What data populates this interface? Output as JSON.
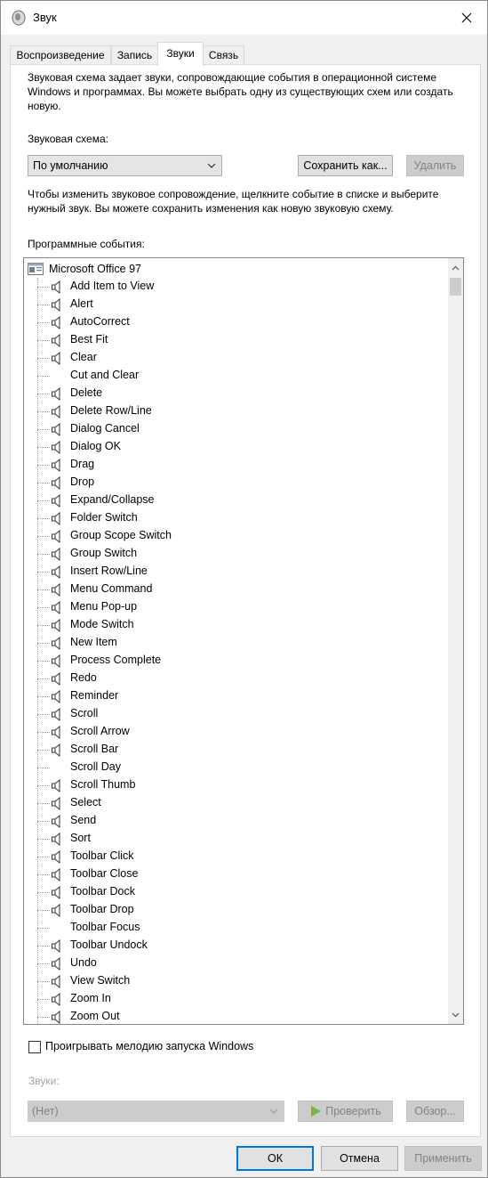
{
  "window": {
    "title": "Звук"
  },
  "tabs": [
    {
      "label": "Воспроизведение"
    },
    {
      "label": "Запись"
    },
    {
      "label": "Звуки"
    },
    {
      "label": "Связь"
    }
  ],
  "intro_text": "Звуковая схема задает звуки, сопровождающие события в операционной системе Windows и программах. Вы можете выбрать одну из существующих схем или создать новую.",
  "scheme": {
    "label": "Звуковая схема:",
    "selected": "По умолчанию",
    "save_button": "Сохранить как...",
    "delete_button": "Удалить"
  },
  "instructions_text": "Чтобы изменить звуковое сопровождение, щелкните событие в списке и выберите нужный звук. Вы можете сохранить изменения как новую звуковую схему.",
  "events": {
    "label": "Программные события:",
    "root": "Microsoft Office 97",
    "items": [
      {
        "label": "Add Item to View",
        "has_sound": true
      },
      {
        "label": "Alert",
        "has_sound": true
      },
      {
        "label": "AutoCorrect",
        "has_sound": true
      },
      {
        "label": "Best Fit",
        "has_sound": true
      },
      {
        "label": "Clear",
        "has_sound": true
      },
      {
        "label": "Cut and Clear",
        "has_sound": false
      },
      {
        "label": "Delete",
        "has_sound": true
      },
      {
        "label": "Delete Row/Line",
        "has_sound": true
      },
      {
        "label": "Dialog Cancel",
        "has_sound": true
      },
      {
        "label": "Dialog OK",
        "has_sound": true
      },
      {
        "label": "Drag",
        "has_sound": true
      },
      {
        "label": "Drop",
        "has_sound": true
      },
      {
        "label": "Expand/Collapse",
        "has_sound": true
      },
      {
        "label": "Folder Switch",
        "has_sound": true
      },
      {
        "label": "Group Scope Switch",
        "has_sound": true
      },
      {
        "label": "Group Switch",
        "has_sound": true
      },
      {
        "label": "Insert Row/Line",
        "has_sound": true
      },
      {
        "label": "Menu Command",
        "has_sound": true
      },
      {
        "label": "Menu Pop-up",
        "has_sound": true
      },
      {
        "label": "Mode Switch",
        "has_sound": true
      },
      {
        "label": "New Item",
        "has_sound": true
      },
      {
        "label": "Process Complete",
        "has_sound": true
      },
      {
        "label": "Redo",
        "has_sound": true
      },
      {
        "label": "Reminder",
        "has_sound": true
      },
      {
        "label": "Scroll",
        "has_sound": true
      },
      {
        "label": "Scroll Arrow",
        "has_sound": true
      },
      {
        "label": "Scroll Bar",
        "has_sound": true
      },
      {
        "label": "Scroll Day",
        "has_sound": false
      },
      {
        "label": "Scroll Thumb",
        "has_sound": true
      },
      {
        "label": "Select",
        "has_sound": true
      },
      {
        "label": "Send",
        "has_sound": true
      },
      {
        "label": "Sort",
        "has_sound": true
      },
      {
        "label": "Toolbar Click",
        "has_sound": true
      },
      {
        "label": "Toolbar Close",
        "has_sound": true
      },
      {
        "label": "Toolbar Dock",
        "has_sound": true
      },
      {
        "label": "Toolbar Drop",
        "has_sound": true
      },
      {
        "label": "Toolbar Focus",
        "has_sound": false
      },
      {
        "label": "Toolbar Undock",
        "has_sound": true
      },
      {
        "label": "Undo",
        "has_sound": true
      },
      {
        "label": "View Switch",
        "has_sound": true
      },
      {
        "label": "Zoom In",
        "has_sound": true
      },
      {
        "label": "Zoom Out",
        "has_sound": true
      }
    ]
  },
  "startup_checkbox": {
    "label": "Проигрывать мелодию запуска Windows",
    "checked": false
  },
  "sounds": {
    "label": "Звуки:",
    "selected": "(Нет)",
    "test_button": "Проверить",
    "browse_button": "Обзор..."
  },
  "footer": {
    "ok": "ОК",
    "cancel": "Отмена",
    "apply": "Применить"
  },
  "colors": {
    "accent": "#0078d7",
    "play_icon": "#7cb342"
  }
}
